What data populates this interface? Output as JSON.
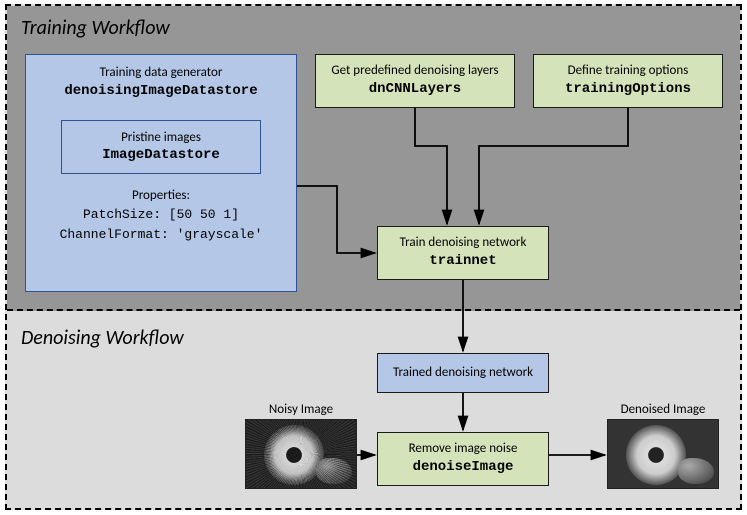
{
  "sections": {
    "training_title": "Training Workflow",
    "denoising_title": "Denoising Workflow"
  },
  "generator": {
    "label": "Training data generator",
    "code": "denoisingImageDatastore",
    "sub_label": "Pristine images",
    "sub_code": "ImageDatastore",
    "props_head": "Properties:",
    "prop1": "PatchSize: [50 50 1]",
    "prop2": "ChannelFormat: 'grayscale'"
  },
  "layers": {
    "label": "Get predefined denoising layers",
    "code": "dnCNNLayers"
  },
  "options": {
    "label": "Define training options",
    "code": "trainingOptions"
  },
  "train": {
    "label": "Train denoising network",
    "code": "trainnet"
  },
  "trained": {
    "label": "Trained denoising network"
  },
  "denoise": {
    "label": "Remove image noise",
    "code": "denoiseImage"
  },
  "images": {
    "noisy_label": "Noisy Image",
    "denoised_label": "Denoised Image"
  }
}
